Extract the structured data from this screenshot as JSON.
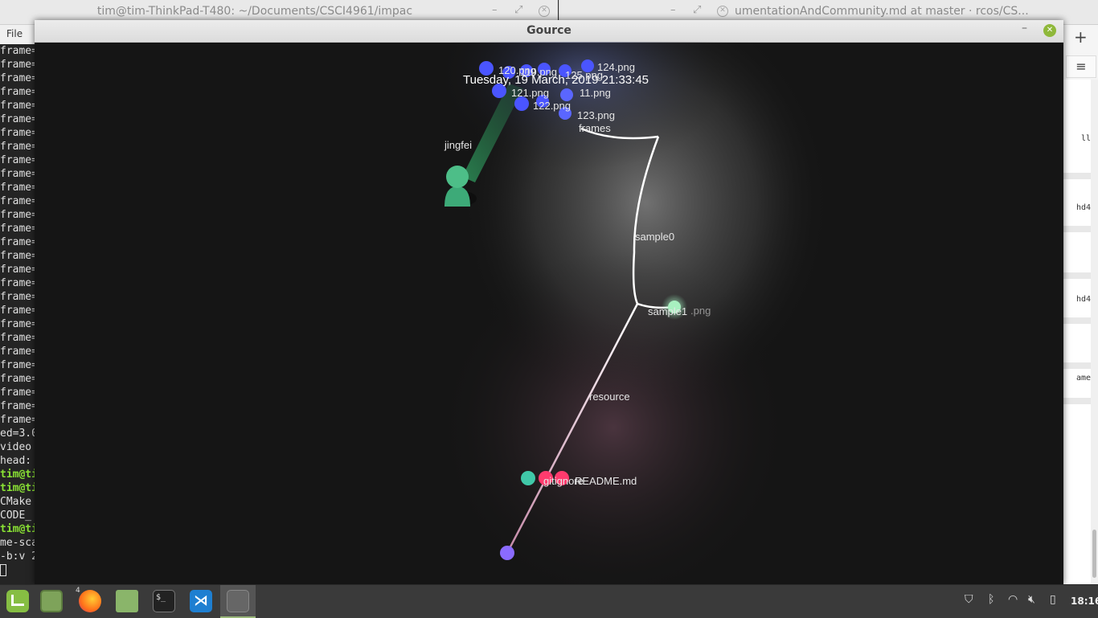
{
  "terminal": {
    "title": "tim@tim-ThinkPad-T480: ~/Documents/CSCI4961/impac",
    "menu_file": "File",
    "lines": [
      {
        "text": "frame=",
        "green": false
      },
      {
        "text": "frame=",
        "green": false
      },
      {
        "text": "frame=",
        "green": false
      },
      {
        "text": "frame=",
        "green": false
      },
      {
        "text": "frame=",
        "green": false
      },
      {
        "text": "frame=",
        "green": false
      },
      {
        "text": "frame=",
        "green": false
      },
      {
        "text": "frame=",
        "green": false
      },
      {
        "text": "frame=",
        "green": false
      },
      {
        "text": "frame=",
        "green": false
      },
      {
        "text": "frame=",
        "green": false
      },
      {
        "text": "frame=",
        "green": false
      },
      {
        "text": "frame=",
        "green": false
      },
      {
        "text": "frame=",
        "green": false
      },
      {
        "text": "frame=",
        "green": false
      },
      {
        "text": "frame=",
        "green": false
      },
      {
        "text": "frame=",
        "green": false
      },
      {
        "text": "frame=",
        "green": false
      },
      {
        "text": "frame=",
        "green": false
      },
      {
        "text": "frame=",
        "green": false
      },
      {
        "text": "frame=",
        "green": false
      },
      {
        "text": "frame=",
        "green": false
      },
      {
        "text": "frame=",
        "green": false
      },
      {
        "text": "frame=",
        "green": false
      },
      {
        "text": "frame=",
        "green": false
      },
      {
        "text": "frame=",
        "green": false
      },
      {
        "text": "frame=",
        "green": false
      },
      {
        "text": "frame=",
        "green": false
      },
      {
        "text": "ed=3.0",
        "green": false
      },
      {
        "text": "video",
        "green": false
      },
      {
        "text": "head:",
        "green": false
      },
      {
        "text": "tim@ti",
        "green": true
      },
      {
        "text": "tim@ti",
        "green": true
      },
      {
        "text": "CMake",
        "green": false
      },
      {
        "text": "CODE_",
        "green": false
      },
      {
        "text": "tim@ti",
        "green": true
      },
      {
        "text": "me-sca",
        "green": false
      },
      {
        "text": "-b:v 2",
        "green": false
      }
    ]
  },
  "browser": {
    "title": "umentationAndCommunity.md at master · rcos/CS...",
    "new_tab": "+",
    "menu_icon": "≡",
    "fragments": [
      "ll",
      "hd4",
      "hd4",
      "ame"
    ]
  },
  "gource": {
    "title": "Gource",
    "date": "Tuesday, 19 March, 2019 21:33:45",
    "user": "jingfei",
    "dirs": {
      "frames": "frames",
      "sample0": "sample0",
      "sample1": "sample1",
      "resource": "resource"
    },
    "files": {
      "f120": "120.png",
      "f124": "124.png",
      "f121": "121.png",
      "f122": "122.png",
      "f123": "123.png",
      "f125": "125.png",
      "f119": "119.png",
      "f11x": "11.png",
      "fsample1": ".png",
      "fgit": "gitignore",
      "freadme": "README.md"
    },
    "colors": {
      "png": "#4a55ff",
      "md": "#ff3b6e",
      "git": "#40c8a8",
      "user": "#3daa78",
      "root": "#8a6bff",
      "branch": "#ffffff"
    }
  },
  "taskbar": {
    "firefox_badge": "4",
    "terminal_glyph": "$_",
    "vscode_glyph": "⋊",
    "clock": "18:16"
  }
}
